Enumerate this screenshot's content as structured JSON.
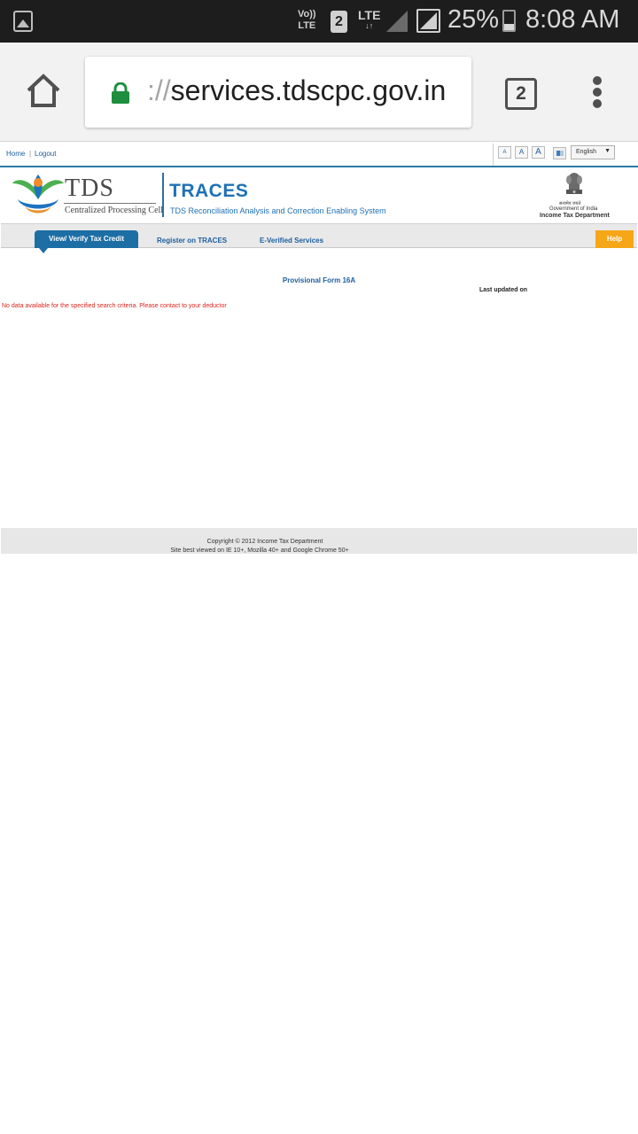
{
  "status_bar": {
    "volte_line1": "Vo))",
    "volte_line2": "LTE",
    "sim_slot": "2",
    "network": "LTE",
    "battery": "25%",
    "time": "8:08 AM"
  },
  "browser": {
    "url_scheme": "://",
    "url_host": "services.tdscpc.gov.in",
    "tab_count": "2",
    "secure_color": "#1e8e3e"
  },
  "topnav": {
    "home": "Home",
    "separator": "|",
    "logout": "Logout",
    "font_small": "A",
    "font_medium": "A",
    "font_large": "A",
    "language": "English"
  },
  "header": {
    "tds": "TDS",
    "tds_subtitle": "Centralized Processing Cell",
    "traces": "TRACES",
    "traces_subtitle": "TDS Reconciliation Analysis and Correction Enabling System",
    "emblem_hindi": "सत्यमेव जयते",
    "goi": "Government of India",
    "department": "Income Tax Department"
  },
  "menu": {
    "active": "View/ Verify Tax Credit",
    "register": "Register on TRACES",
    "everified": "E-Verified Services",
    "help": "Help"
  },
  "content": {
    "form_title": "Provisional Form 16A",
    "last_updated": "Last updated on",
    "no_data_message": "No data available for the specified search criteria. Please contact to your deductor"
  },
  "footer": {
    "copyright": "Copyright © 2012 Income Tax Department",
    "best_viewed": "Site best viewed on IE 10+, Mozilla 40+ and Google Chrome 50+"
  },
  "colors": {
    "brand_blue": "#2071b5",
    "help_orange": "#f5a718",
    "error_red": "#d9261c"
  }
}
